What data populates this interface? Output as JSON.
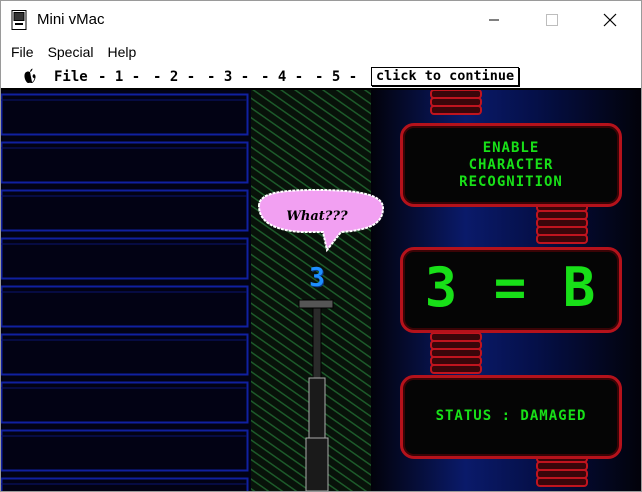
{
  "window": {
    "title": "Mini vMac"
  },
  "host_menu": [
    "File",
    "Special",
    "Help"
  ],
  "mac_menu": {
    "items": [
      "File",
      "- 1 -",
      "- 2 -",
      "- 3 -",
      "- 4 -",
      "- 5 -"
    ],
    "continue_label": "click to continue"
  },
  "scene": {
    "speech_bubble": "What???",
    "pole_digit": "3",
    "panel_top_lines": [
      "ENABLE",
      "CHARACTER",
      "RECOGNITION"
    ],
    "panel_middle": "3 = B",
    "panel_bottom": "STATUS : DAMAGED"
  },
  "colors": {
    "panel_text": "#18e018",
    "panel_border": "#b5121b",
    "bubble": "#f2a0f2",
    "digit": "#1e8fff"
  },
  "icons": [
    "app-icon",
    "minimize-icon",
    "maximize-icon",
    "close-icon",
    "apple-icon"
  ]
}
